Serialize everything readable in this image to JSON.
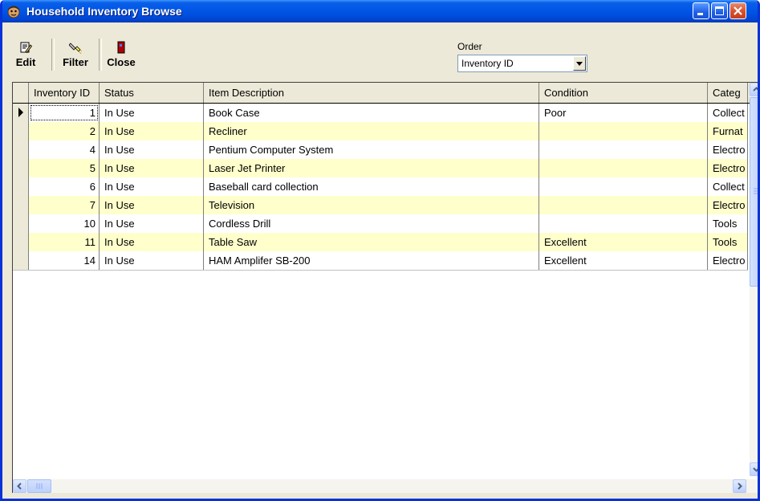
{
  "window": {
    "title": "Household Inventory Browse",
    "icon": "app-face-icon"
  },
  "toolbar": {
    "edit_label": "Edit",
    "filter_label": "Filter",
    "close_label": "Close"
  },
  "order": {
    "label": "Order",
    "selected": "Inventory ID"
  },
  "grid": {
    "columns": [
      "Inventory ID",
      "Status",
      "Item Description",
      "Condition",
      "Categ"
    ],
    "rows": [
      {
        "id": "1",
        "status": "In Use",
        "description": "Book Case",
        "condition": "Poor",
        "category": "Collect"
      },
      {
        "id": "2",
        "status": "In Use",
        "description": "Recliner",
        "condition": "",
        "category": "Furnat"
      },
      {
        "id": "4",
        "status": "In Use",
        "description": "Pentium Computer System",
        "condition": "",
        "category": "Electro"
      },
      {
        "id": "5",
        "status": "In Use",
        "description": "Laser Jet Printer",
        "condition": "",
        "category": "Electro"
      },
      {
        "id": "6",
        "status": "In Use",
        "description": "Baseball card collection",
        "condition": "",
        "category": "Collect"
      },
      {
        "id": "7",
        "status": "In Use",
        "description": "Television",
        "condition": "",
        "category": "Electro"
      },
      {
        "id": "10",
        "status": "In Use",
        "description": "Cordless Drill",
        "condition": "",
        "category": "Tools"
      },
      {
        "id": "11",
        "status": "In Use",
        "description": "Table Saw",
        "condition": "Excellent",
        "category": "Tools"
      },
      {
        "id": "14",
        "status": "In Use",
        "description": "HAM Amplifer SB-200",
        "condition": "Excellent",
        "category": "Electro"
      }
    ]
  },
  "colors": {
    "title_bar": "#0055e5",
    "alt_row": "#ffffcc",
    "window_face": "#ece9d8"
  }
}
